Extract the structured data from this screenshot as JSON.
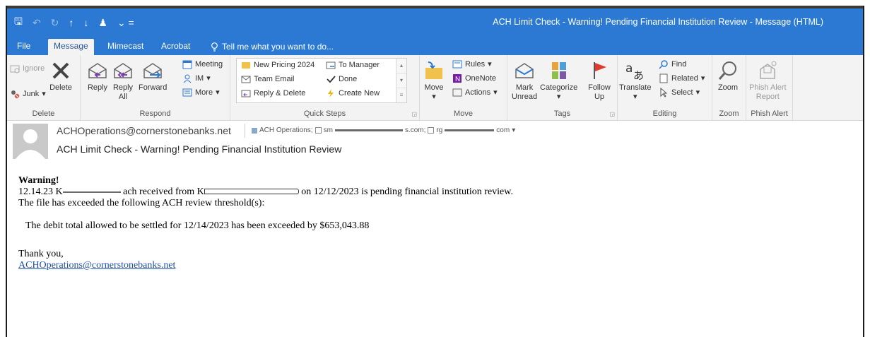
{
  "titlebar": {
    "window_title": "ACH Limit Check - Warning!  Pending Financial Institution Review - Message (HTML)",
    "qat": {
      "save": "🖫",
      "undo": "↶",
      "redo": "↻",
      "up": "↑",
      "down": "↓",
      "person": "♟",
      "more": "⌄ ="
    }
  },
  "tabs": {
    "file": "File",
    "message": "Message",
    "mimecast": "Mimecast",
    "acrobat": "Acrobat",
    "tell_me": "Tell me what you want to do..."
  },
  "ribbon": {
    "delete_group": {
      "ignore": "Ignore",
      "junk": "Junk",
      "delete": "Delete",
      "label": "Delete"
    },
    "respond_group": {
      "reply": "Reply",
      "reply_all_1": "Reply",
      "reply_all_2": "All",
      "forward": "Forward",
      "meeting": "Meeting",
      "im": "IM",
      "more": "More",
      "label": "Respond"
    },
    "quick_steps": {
      "new_pricing": "New Pricing 2024",
      "to_manager": "To Manager",
      "team_email": "Team Email",
      "done": "Done",
      "reply_delete": "Reply & Delete",
      "create_new": "Create New",
      "label": "Quick Steps"
    },
    "move_group": {
      "move": "Move",
      "rules": "Rules",
      "onenote": "OneNote",
      "actions": "Actions",
      "label": "Move"
    },
    "tags_group": {
      "mark_unread_1": "Mark",
      "mark_unread_2": "Unread",
      "categorize": "Categorize",
      "follow_up_1": "Follow",
      "follow_up_2": "Up",
      "label": "Tags"
    },
    "editing_group": {
      "translate": "Translate",
      "find": "Find",
      "related": "Related",
      "select": "Select",
      "label": "Editing"
    },
    "zoom_group": {
      "zoom": "Zoom",
      "label": "Zoom"
    },
    "phish_group": {
      "phish_1": "Phish Alert",
      "phish_2": "Report",
      "label": "Phish Alert"
    }
  },
  "header": {
    "from": "ACHOperations@cornerstonebanks.net",
    "to_label": "ACH Operations;",
    "recipient_1_prefix": "sm",
    "recipient_1_suffix": "s.com;",
    "recipient_2_prefix": "rg",
    "recipient_2_suffix": "com",
    "subject": "ACH Limit Check - Warning!  Pending Financial Institution Review"
  },
  "body": {
    "warning": "Warning!",
    "line1_a": "12.14.23 K",
    "line1_b": "ach received from K",
    "line1_c": "on 12/12/2023 is pending financial institution review.",
    "line2": "The file has exceeded the following ACH review threshold(s):",
    "line3": "The debit total allowed to be settled for 12/14/2023 has been exceeded by $653,043.88",
    "thanks": "Thank you,",
    "signature_link": "ACHOperations@cornerstonebanks.net"
  },
  "colors": {
    "titlebar": "#2b79d2",
    "ribbon": "#f3f3f3",
    "link": "#1f4fa8"
  }
}
